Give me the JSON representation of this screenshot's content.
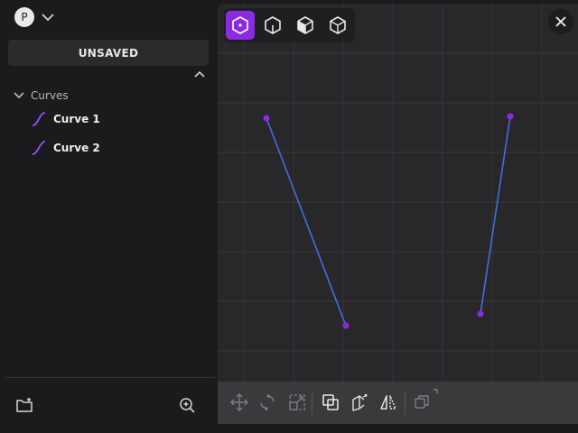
{
  "user": {
    "initial": "P"
  },
  "file": {
    "status": "UNSAVED"
  },
  "tree": {
    "group_label": "Curves",
    "items": [
      {
        "label": "Curve 1"
      },
      {
        "label": "Curve 2"
      }
    ]
  },
  "view_modes": [
    "top-view-icon",
    "front-view-icon",
    "side-view-icon",
    "perspective-view-icon"
  ],
  "active_view": 0,
  "tools": [
    "move-icon",
    "rotate-icon",
    "scale-icon",
    "boolean-icon",
    "extrude-icon",
    "mirror-icon",
    "duplicate-icon"
  ],
  "colors": {
    "accent": "#8a2be2",
    "curve": "#3f6fe0",
    "point": "#8a2be2"
  }
}
